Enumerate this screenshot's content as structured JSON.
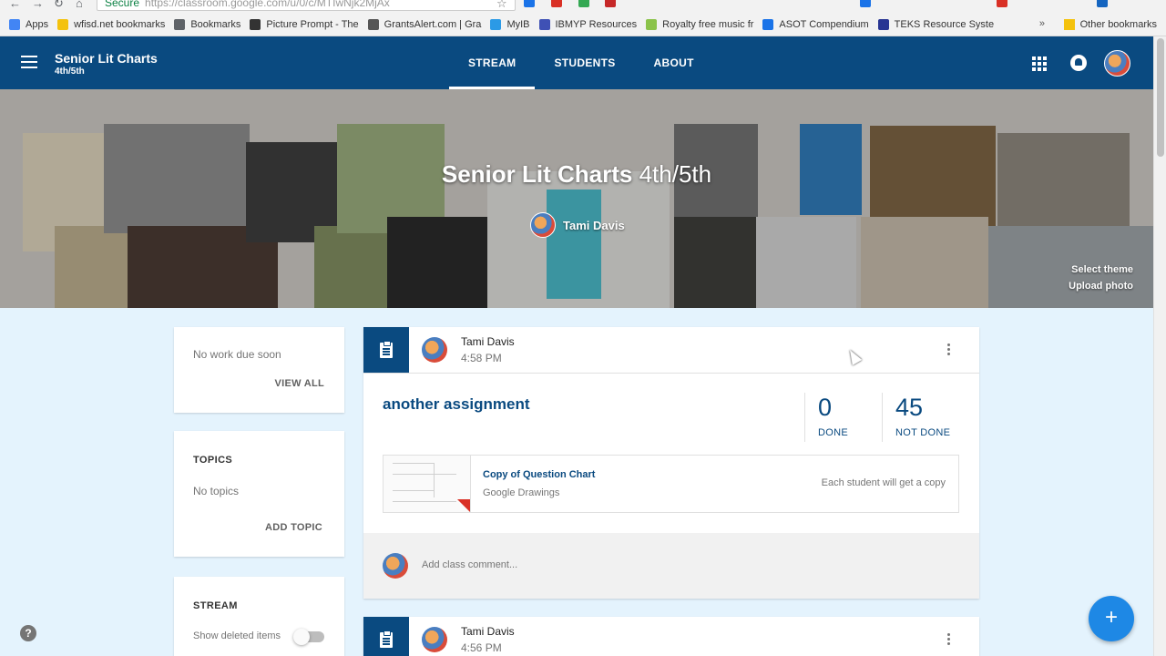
{
  "browser": {
    "secure_label": "Secure",
    "url": "https://classroom.google.com/u/0/c/MTIwNjk2MjAx",
    "bookmarks": [
      {
        "label": "Apps",
        "color": "#4285f4"
      },
      {
        "label": "wfisd.net bookmarks",
        "color": "#f4c20d"
      },
      {
        "label": "Bookmarks",
        "color": "#5f6368"
      },
      {
        "label": "Picture Prompt - The",
        "color": "#333333"
      },
      {
        "label": "GrantsAlert.com | Gra",
        "color": "#555555"
      },
      {
        "label": "MyIB",
        "color": "#2b9ae6"
      },
      {
        "label": "IBMYP Resources",
        "color": "#3f51b5"
      },
      {
        "label": "Royalty free music fr",
        "color": "#8bc34a"
      },
      {
        "label": "ASOT Compendium",
        "color": "#1a73e8"
      },
      {
        "label": "TEKS Resource Syste",
        "color": "#283593"
      }
    ],
    "other_bookmarks": "Other bookmarks"
  },
  "header": {
    "class_name": "Senior Lit Charts",
    "section": "4th/5th",
    "tabs": [
      {
        "label": "STREAM",
        "active": true
      },
      {
        "label": "STUDENTS",
        "active": false
      },
      {
        "label": "ABOUT",
        "active": false
      }
    ]
  },
  "banner": {
    "title": "Senior Lit Charts",
    "section": "4th/5th",
    "teacher": "Tami Davis",
    "select_theme": "Select theme",
    "upload_photo": "Upload photo"
  },
  "sidebar": {
    "upcoming": {
      "message": "No work due soon",
      "action": "VIEW ALL"
    },
    "topics": {
      "heading": "TOPICS",
      "message": "No topics",
      "action": "ADD TOPIC"
    },
    "stream": {
      "heading": "STREAM",
      "toggle_label": "Show deleted items",
      "toggle_on": false
    }
  },
  "posts": [
    {
      "author": "Tami Davis",
      "time": "4:58 PM",
      "title": "another assignment",
      "done_count": "0",
      "done_label": "DONE",
      "not_done_count": "45",
      "not_done_label": "NOT DONE",
      "attachment": {
        "title": "Copy of Question Chart",
        "type": "Google Drawings",
        "note": "Each student will get a copy"
      },
      "comment_placeholder": "Add class comment..."
    },
    {
      "author": "Tami Davis",
      "time": "4:56 PM"
    }
  ],
  "colors": {
    "primary": "#0a4a80",
    "fab": "#1e88e5",
    "page_bg": "#e4f3fd"
  }
}
